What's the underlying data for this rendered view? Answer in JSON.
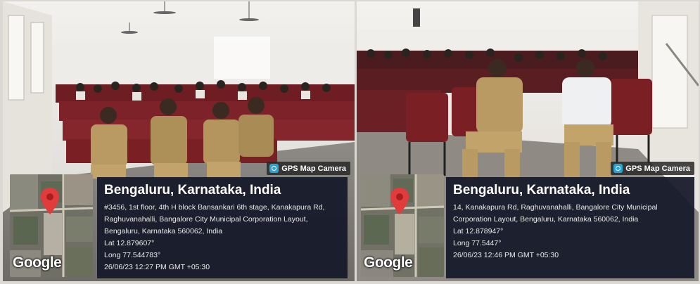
{
  "left": {
    "camera_badge": "GPS Map Camera",
    "map_brand": "Google",
    "title": "Bengaluru, Karnataka, India",
    "address": "#3456, 1st floor, 4th H block Bansankari 6th stage, Kanakapura Rd, Raghuvanahalli, Bangalore City Municipal Corporation Layout, Bengaluru, Karnataka 560062, India",
    "lat": "Lat 12.879607°",
    "long": "Long 77.544783°",
    "timestamp": "26/06/23 12:27 PM GMT +05:30",
    "icons": {
      "badge": "camera-icon",
      "pin": "map-pin-icon"
    }
  },
  "right": {
    "camera_badge": "GPS Map Camera",
    "map_brand": "Google",
    "title": "Bengaluru, Karnataka, India",
    "address": "14, Kanakapura Rd, Raghuvanahalli, Bangalore City Municipal Corporation Layout, Bengaluru, Karnataka 560062, India",
    "lat": "Lat 12.878947°",
    "long": "Long 77.5447°",
    "timestamp": "26/06/23 12:46 PM GMT +05:30",
    "icons": {
      "badge": "camera-icon",
      "pin": "map-pin-icon"
    }
  },
  "colors": {
    "pin_red": "#e23b3b",
    "info_bg": "#14182a",
    "badge_blue": "#2aa3d8",
    "seat_red": "#7a1f24",
    "uniform_khaki": "#b89a62"
  }
}
